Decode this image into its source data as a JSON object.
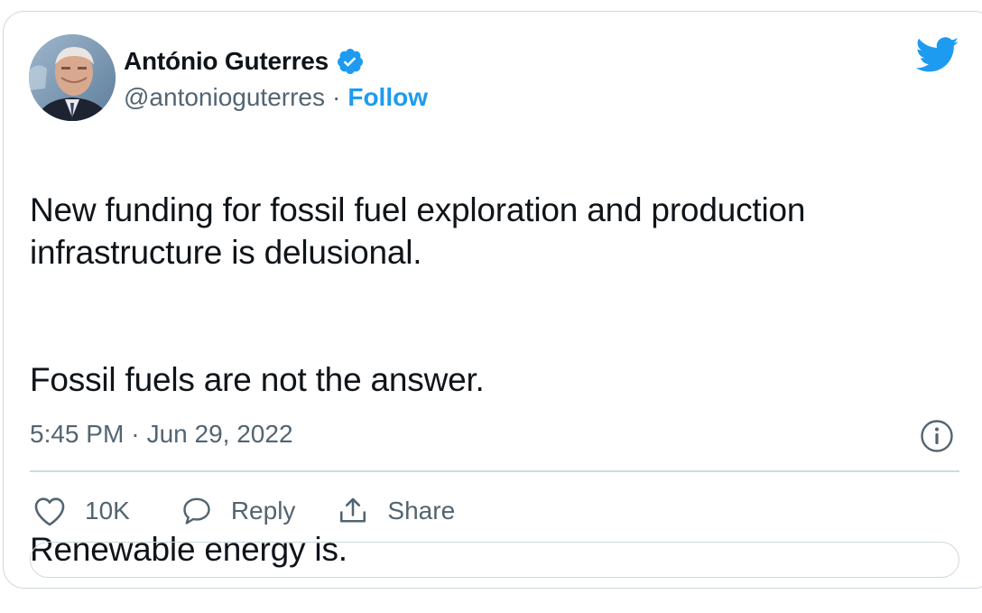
{
  "author": {
    "name": "António Guterres",
    "handle": "@antonioguterres",
    "separator": "·",
    "follow_label": "Follow"
  },
  "tweet": {
    "paragraphs": [
      "New funding for fossil fuel exploration and production infrastructure is delusional.",
      "Fossil fuels are not the answer.",
      "Renewable energy is."
    ],
    "time": "5:45 PM",
    "date": "Jun 29, 2022",
    "time_separator": "·"
  },
  "actions": {
    "like_count": "10K",
    "reply_label": "Reply",
    "share_label": "Share"
  },
  "icons": [
    "verified-icon",
    "twitter-bird-icon",
    "info-icon",
    "heart-icon",
    "reply-icon",
    "share-icon"
  ],
  "colors": {
    "accent": "#1d9bf0",
    "secondary_text": "#536471",
    "primary_text": "#0f1419",
    "border": "#cfd9de"
  }
}
